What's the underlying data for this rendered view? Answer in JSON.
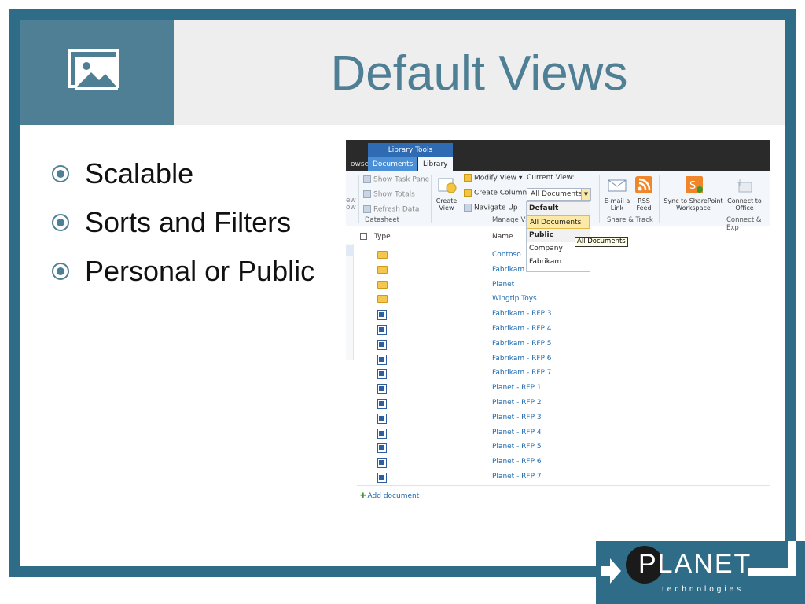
{
  "slide": {
    "title": "Default Views",
    "bullets": [
      "Scalable",
      "Sorts and Filters",
      "Personal or Public"
    ]
  },
  "logo": {
    "name": "PLANET",
    "sub": "technologies"
  },
  "sharepoint": {
    "contextual_tab": "Library Tools",
    "tabs": {
      "browse": "owse",
      "documents": "Documents",
      "library": "Library"
    },
    "ribbon": {
      "show_task_pane": "Show Task Pane",
      "show_totals": "Show Totals",
      "refresh_data": "Refresh Data",
      "datasheet_group": "Datasheet",
      "create_view": "Create View",
      "modify_view": "Modify View",
      "create_column": "Create Column",
      "navigate_up": "Navigate Up",
      "current_view_label": "Current View:",
      "current_view_value": "All Documents",
      "manage_views_group": "Manage Vi",
      "email_link": "E-mail a Link",
      "rss_feed": "RSS Feed",
      "share_track_group": "Share & Track",
      "sync_workspace": "Sync to SharePoint Workspace",
      "connect_office": "Connect to Office",
      "connect_export_group": "Connect & Exp",
      "left_cut_1": "ew",
      "left_cut_2": "ow"
    },
    "dropdown": {
      "default_header": "Default",
      "selected": "All Documents",
      "public_header": "Public",
      "items": [
        "Company",
        "Fabrikam"
      ],
      "tooltip": "All Documents"
    },
    "list": {
      "col_type": "Type",
      "col_name": "Name",
      "folders": [
        "Contoso",
        "Fabrikam",
        "Planet",
        "Wingtip Toys"
      ],
      "documents": [
        "Fabrikam - RFP 3",
        "Fabrikam - RFP 4",
        "Fabrikam - RFP 5",
        "Fabrikam - RFP 6",
        "Fabrikam - RFP 7",
        "Planet - RFP 1",
        "Planet - RFP 2",
        "Planet - RFP 3",
        "Planet - RFP 4",
        "Planet - RFP 5",
        "Planet - RFP 6",
        "Planet - RFP 7"
      ],
      "add_document": "Add document"
    }
  },
  "colors": {
    "frame": "#2f6c88",
    "title": "#4f7f94",
    "link": "#1e6ab0"
  },
  "icons": {
    "title_placeholder": "picture-icon",
    "bullet": "circle-bullet-icon"
  }
}
